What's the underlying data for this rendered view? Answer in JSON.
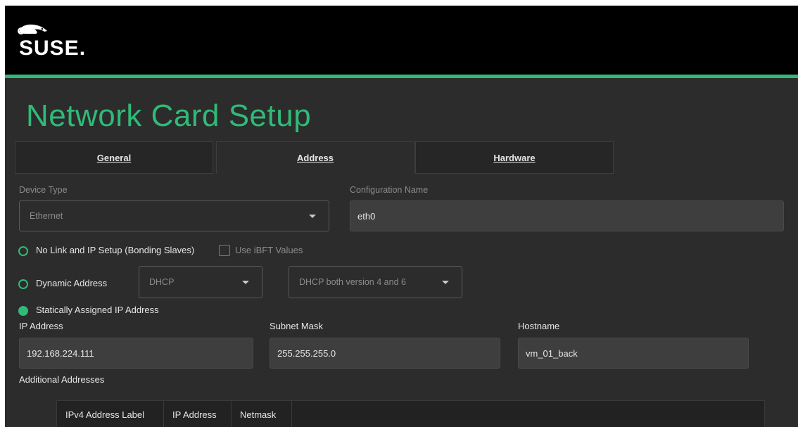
{
  "brand": {
    "logo_text": "SUSE.",
    "accent_color": "#30ba78"
  },
  "page": {
    "title": "Network Card Setup"
  },
  "tabs": [
    {
      "label": "General",
      "active": false
    },
    {
      "label": "Address",
      "active": true
    },
    {
      "label": "Hardware",
      "active": false
    }
  ],
  "device_type": {
    "label": "Device Type",
    "value": "Ethernet"
  },
  "configuration_name": {
    "label": "Configuration Name",
    "value": "eth0"
  },
  "options": {
    "no_link": {
      "label": "No Link and IP Setup (Bonding Slaves)",
      "selected": false
    },
    "use_ibft": {
      "label": "Use iBFT Values",
      "checked": false
    },
    "dynamic": {
      "label": "Dynamic Address",
      "selected": false,
      "mode": "DHCP",
      "version": "DHCP both version 4 and 6"
    },
    "static": {
      "label": "Statically Assigned IP Address",
      "selected": true
    }
  },
  "static_fields": {
    "ip_label": "IP Address",
    "ip_value": "192.168.224.111",
    "mask_label": "Subnet Mask",
    "mask_value": "255.255.255.0",
    "host_label": "Hostname",
    "host_value": "vm_01_back"
  },
  "additional": {
    "label": "Additional Addresses",
    "columns": [
      "IPv4 Address Label",
      "IP Address",
      "Netmask"
    ]
  }
}
